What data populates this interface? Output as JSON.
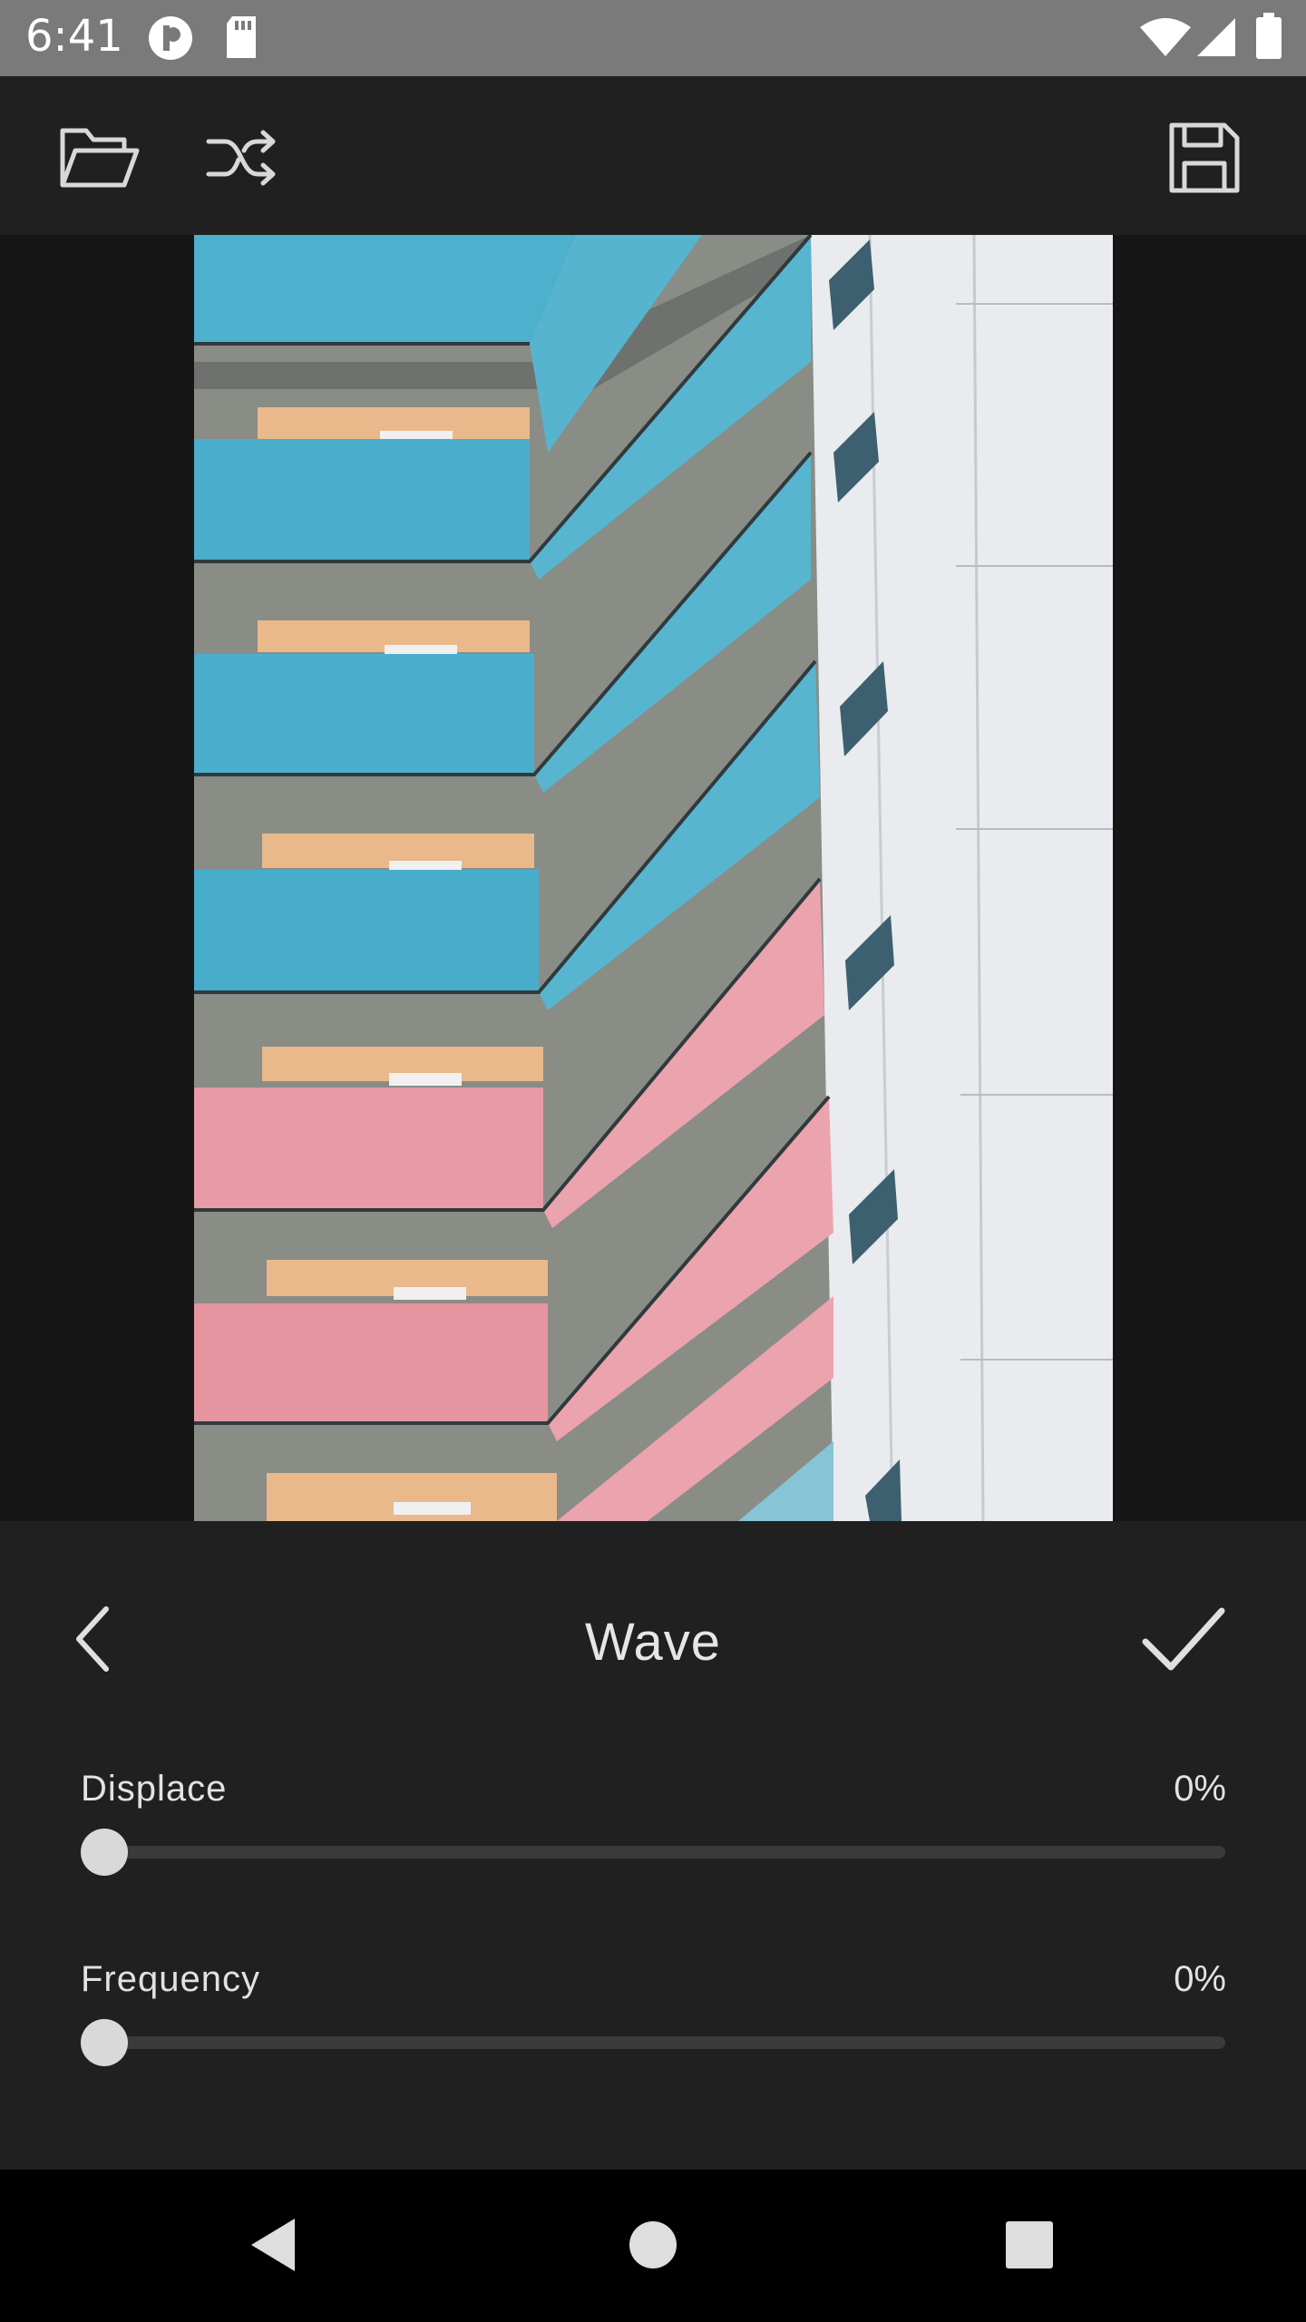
{
  "status_bar": {
    "time": "6:41",
    "icons_left": [
      "circle-p-icon",
      "sd-card-icon"
    ],
    "icons_right": [
      "wifi-icon",
      "cell-signal-icon",
      "battery-icon"
    ]
  },
  "toolbar": {
    "open_icon": "folder-open-icon",
    "shuffle_icon": "shuffle-icon",
    "save_icon": "save-icon"
  },
  "panel": {
    "title": "Wave",
    "back_icon": "chevron-left-icon",
    "apply_icon": "check-icon",
    "sliders": [
      {
        "label": "Displace",
        "value_text": "0%",
        "value": 0
      },
      {
        "label": "Frequency",
        "value_text": "0%",
        "value": 0
      }
    ]
  },
  "nav_bar": {
    "icons": [
      "back-triangle-icon",
      "home-circle-icon",
      "recents-square-icon"
    ]
  },
  "colors": {
    "accent_blue": "#4aaecc",
    "accent_pink": "#e89aa6",
    "panel_bg": "#202020",
    "thumb": "#d9d9d9"
  }
}
